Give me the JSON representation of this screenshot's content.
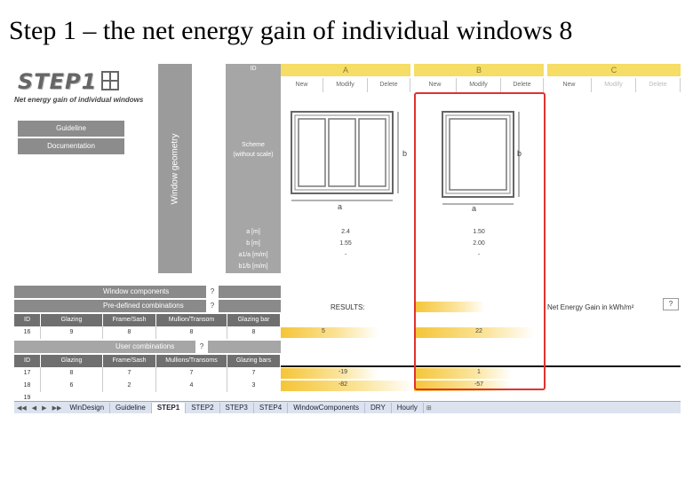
{
  "slide": {
    "title": "Step 1 – the net energy gain of individual windows 8"
  },
  "left_panel": {
    "logo_text": "STEP1",
    "subtitle": "Net energy gain of individual windows",
    "buttons": [
      "Guideline",
      "Documentation"
    ],
    "geometry_label": "Window geometry"
  },
  "header": {
    "id_label": "ID",
    "columns": [
      {
        "letter": "A",
        "actions": [
          "New",
          "Modify",
          "Delete"
        ]
      },
      {
        "letter": "B",
        "actions": [
          "New",
          "Modify",
          "Delete"
        ]
      },
      {
        "letter": "C",
        "actions": [
          "New",
          "Modify",
          "Delete"
        ]
      }
    ]
  },
  "scheme": {
    "label_line1": "Scheme",
    "label_line2": "(without scale)",
    "dim_a": "a",
    "dim_b": "b"
  },
  "params": {
    "labels": [
      "a [m]",
      "b [m]",
      "a1/a [m/m]",
      "b1/b [m/m]"
    ],
    "A": [
      "2.4",
      "1.55",
      "-",
      ""
    ],
    "B": [
      "1.50",
      "2.00",
      "-",
      ""
    ]
  },
  "components": {
    "title": "Window components",
    "help": "?",
    "predefined_title": "Pre-defined combinations",
    "user_title": "User combinations",
    "headers": [
      "ID",
      "Glazing",
      "Frame/Sash",
      "Mullion/Transom",
      "Glazing bar"
    ],
    "headers_user": [
      "ID",
      "Glazing",
      "Frame/Sash",
      "Mullions/Transoms",
      "Glazing bars"
    ],
    "predefined_rows": [
      {
        "id": "16",
        "cells": [
          "9",
          "8",
          "8",
          "8"
        ],
        "A": "5",
        "B": "22"
      }
    ],
    "user_rows": [
      {
        "id": "17",
        "cells": [
          "8",
          "7",
          "7",
          "7"
        ],
        "A": "-19",
        "B": "1"
      },
      {
        "id": "18",
        "cells": [
          "6",
          "2",
          "4",
          "3"
        ],
        "A": "-82",
        "B": "-57"
      },
      {
        "id": "19",
        "cells": [
          "",
          "",
          "",
          ""
        ],
        "A": "",
        "B": ""
      }
    ]
  },
  "results": {
    "label": "RESULTS:",
    "unit_label": "Net Energy Gain in kWh/m²",
    "help": "?"
  },
  "tabs": [
    "WinDesign",
    "Guideline",
    "STEP1",
    "STEP2",
    "STEP3",
    "STEP4",
    "WindowComponents",
    "DRY",
    "Hourly"
  ],
  "active_tab": "STEP1",
  "colors": {
    "highlight": "#e0322e",
    "header_yellow": "#f5dd66",
    "bar_orange": "#f5c537"
  }
}
